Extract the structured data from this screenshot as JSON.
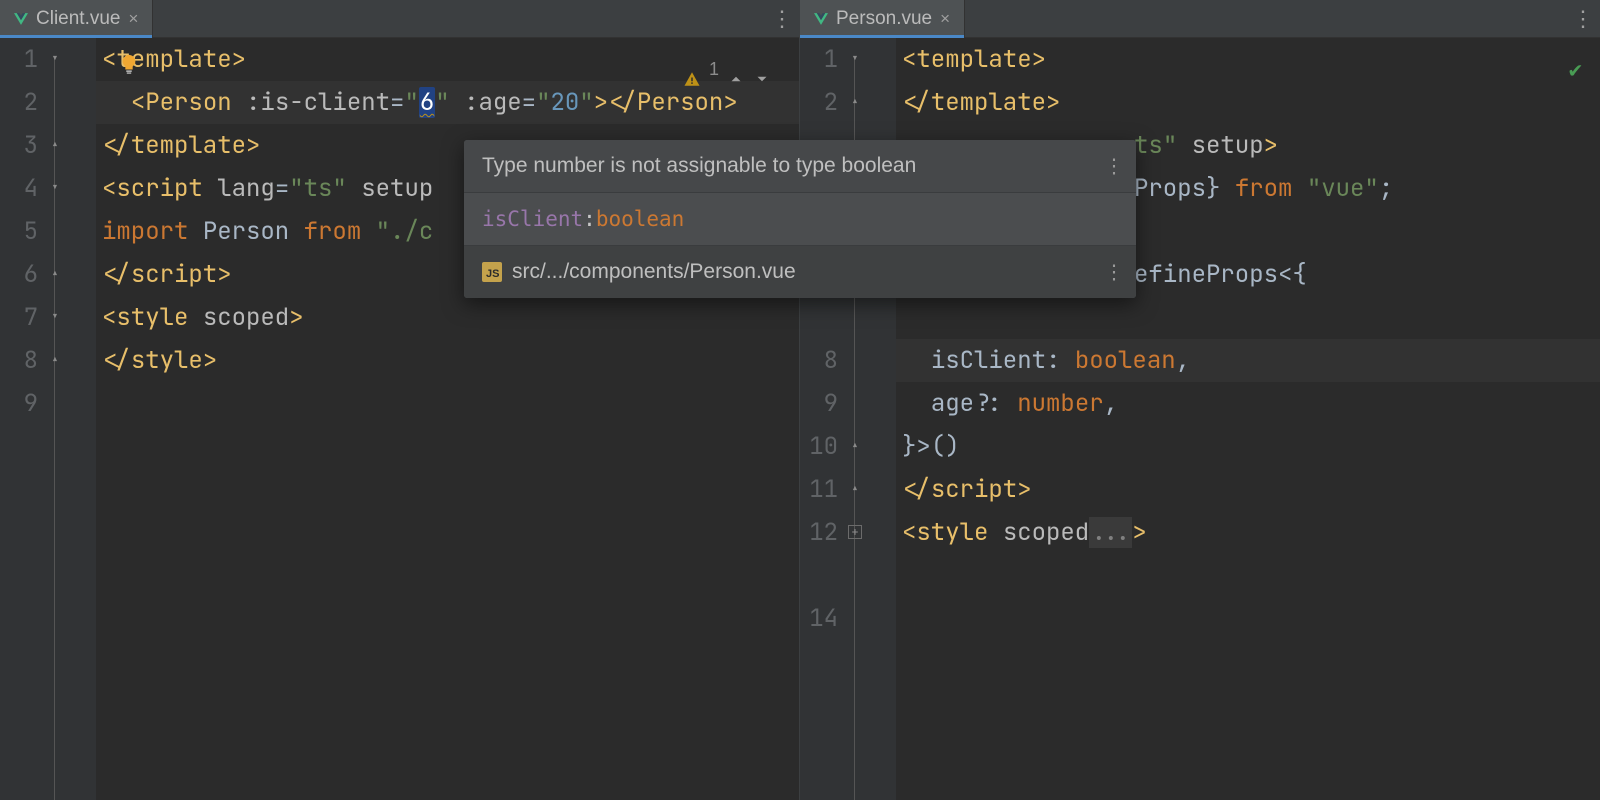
{
  "left": {
    "tab": {
      "filename": "Client.vue"
    },
    "inspection": {
      "count": "1"
    },
    "lines": [
      "1",
      "2",
      "3",
      "4",
      "5",
      "6",
      "7",
      "8",
      "9"
    ],
    "code": {
      "l1": {
        "open": "<",
        "tag": "template",
        "close": ">"
      },
      "l2": {
        "indent": "  ",
        "open": "<",
        "tag": "Person",
        "sp": " ",
        "attr1": ":is-client",
        "eq1": "=",
        "q1a": "\"",
        "val1": "6",
        "q1b": "\"",
        "sp2": " ",
        "attr2": ":age",
        "eq2": "=",
        "q2a": "\"",
        "val2": "20",
        "q2b": "\"",
        "gt1": ">",
        "open2": "</",
        "tag2": "Person",
        "gt2": ">"
      },
      "l3": {
        "open": "</",
        "tag": "template",
        "close": ">"
      },
      "l4": {
        "open": "<",
        "tag": "script",
        "sp": " ",
        "attr1": "lang",
        "eq": "=",
        "val": "\"ts\"",
        "sp2": " ",
        "attr2": "setup"
      },
      "l5": {
        "kw": "import",
        "sp": " ",
        "ident": "Person",
        "sp2": " ",
        "kw2": "from",
        "sp3": " ",
        "path": "\"./c"
      },
      "l6": {
        "open": "</",
        "tag": "script",
        "close": ">"
      },
      "l7": {
        "open": "<",
        "tag": "style",
        "sp": " ",
        "attr": "scoped",
        "close": ">"
      },
      "l8": {
        "open": "</",
        "tag": "style",
        "close": ">"
      }
    }
  },
  "right": {
    "tab": {
      "filename": "Person.vue"
    },
    "lines": [
      "1",
      "2",
      "",
      "",
      "",
      "",
      "",
      "8",
      "9",
      "10",
      "11",
      "12",
      "",
      "14"
    ],
    "code": {
      "l1": {
        "open": "<",
        "tag": "template",
        "close": ">"
      },
      "l2": {
        "open": "</",
        "tag": "template",
        "close": ">"
      },
      "l3": {
        "tail_attr": "ts",
        "tail_q": "\"",
        "sp": " ",
        "tail_attr2": "setup",
        "close": ">"
      },
      "l4": {
        "ident": "Props",
        "brace": "}",
        "sp": " ",
        "kw": "from",
        "sp2": " ",
        "path": "\"vue\"",
        "semi": ";"
      },
      "l6": {
        "ident": "efineProps",
        "lt": "<",
        "brace": "{"
      },
      "l8": {
        "indent": "  ",
        "prop": "isClient",
        "colon": ": ",
        "type": "boolean",
        "comma": ","
      },
      "l9": {
        "indent": "  ",
        "prop": "age",
        "opt": "?",
        "colon": ": ",
        "type": "number",
        "comma": ","
      },
      "l10": {
        "brace": "}",
        "gt": ">",
        "paren": "()"
      },
      "l11": {
        "open": "</",
        "tag": "script",
        "close": ">"
      },
      "l12": {
        "open": "<",
        "tag": "style",
        "sp": " ",
        "attr": "scoped",
        "dots": "...",
        "close": ">"
      }
    }
  },
  "popup": {
    "message": "Type number is not assignable to type boolean",
    "param": "isClient",
    "colon": ": ",
    "ptype": "boolean",
    "location": "src/.../components/Person.vue"
  }
}
